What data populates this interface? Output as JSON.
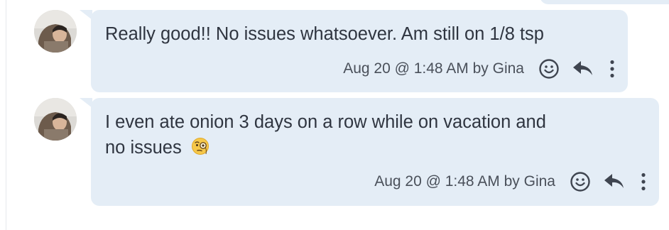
{
  "messages": [
    {
      "text": "Really good!! No issues whatsoever. Am still on 1/8 tsp",
      "meta": "Aug 20 @ 1:48 AM by Gina"
    },
    {
      "text_line1": "I even ate onion 3 days on a row while on vacation and",
      "text_line2": "no issues",
      "emoji": "monocle-face",
      "meta": "Aug 20 @ 1:48 AM by Gina"
    }
  ],
  "icons": {
    "react": "smiley-face-icon",
    "reply": "reply-arrow-icon",
    "more": "vertical-ellipsis-icon"
  },
  "colors": {
    "bubble": "#e4edf6",
    "text": "#2f3540",
    "meta": "#4a505a",
    "icon": "#3f4550"
  }
}
